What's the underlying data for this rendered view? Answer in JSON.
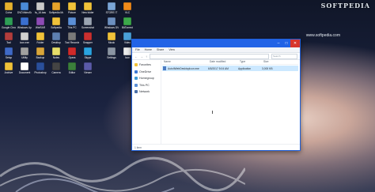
{
  "branding": {
    "logo_text": "SOFTPEDIA",
    "url_text": "www.softpedia.com"
  },
  "desktop": {
    "icons": [
      {
        "label": "Coinz",
        "color": "#e6b12e"
      },
      {
        "label": "DVDVideoSoft",
        "color": "#4a8bd8"
      },
      {
        "label": "fa_16.bas",
        "color": "#c9c9c9"
      },
      {
        "label": "Softpedia Music",
        "color": "#e6a32b"
      },
      {
        "label": "Picture",
        "color": "#f0c23a"
      },
      {
        "label": "New folder",
        "color": "#f0c23a"
      },
      {
        "label": "STORE IT",
        "color": "#7aa5d6"
      },
      {
        "label": "VLC",
        "color": "#f08a1a"
      },
      {
        "label": "Google Chrome",
        "color": "#2f9e56"
      },
      {
        "label": "Windows Update",
        "color": "#3a6fd0"
      },
      {
        "label": "WinRAR",
        "color": "#8c4bb4"
      },
      {
        "label": "Softpedia",
        "color": "#f0c23a"
      },
      {
        "label": "This PC",
        "color": "#5b8fd6"
      },
      {
        "label": "Screenshot",
        "color": "#9aa4b2"
      },
      {
        "label": "Windows DVD",
        "color": "#6c8fbf"
      },
      {
        "label": "BitTorrent",
        "color": "#3ca84a"
      },
      {
        "label": "Tool",
        "color": "#b33d3d"
      },
      {
        "label": "icon.exe",
        "color": "#d0d0d0"
      },
      {
        "label": "Folder",
        "color": "#f0c23a"
      },
      {
        "label": "Desktop",
        "color": "#5d7fb0"
      },
      {
        "label": "Tool Recorder",
        "color": "#7a7a7a"
      },
      {
        "label": "Snapper",
        "color": "#ca3030"
      },
      {
        "label": "Music",
        "color": "#f0c23a"
      },
      {
        "label": "Video",
        "color": "#4aa1d8"
      },
      {
        "label": "Setup",
        "color": "#3f69c6"
      },
      {
        "label": "Utility",
        "color": "#a0a0a0"
      },
      {
        "label": "Backup",
        "color": "#d9a53a"
      },
      {
        "label": "Notes",
        "color": "#e6dd6a"
      },
      {
        "label": "Opera",
        "color": "#cf2a2a"
      },
      {
        "label": "Skype",
        "color": "#2aa3e0"
      },
      {
        "label": "Settings",
        "color": "#8b95a3"
      },
      {
        "label": "Icon",
        "color": "#ededed"
      },
      {
        "label": "Archive",
        "color": "#f0c23a"
      },
      {
        "label": "Document",
        "color": "#ffffff"
      },
      {
        "label": "Photoshop",
        "color": "#2a4f9a"
      },
      {
        "label": "Camera",
        "color": "#444"
      },
      {
        "label": "Editor",
        "color": "#3b7f3b"
      },
      {
        "label": "Viewer",
        "color": "#5a5aa8"
      }
    ]
  },
  "window": {
    "title": "",
    "controls": {
      "minimize": "–",
      "maximize": "□",
      "close": "✕"
    },
    "ribbon": [
      "File",
      "Home",
      "Share",
      "View"
    ],
    "search_placeholder": "Search",
    "nav_items": [
      {
        "label": "Favorites",
        "color": "#f0c23a"
      },
      {
        "label": "OneDrive",
        "color": "#3d7ad6"
      },
      {
        "label": "Homegroup",
        "color": "#3d9ad6"
      },
      {
        "label": "This PC",
        "color": "#5b8fd6"
      },
      {
        "label": "Network",
        "color": "#4a6fa8"
      }
    ],
    "columns": [
      "Name",
      "Date modified",
      "Type",
      "Size"
    ],
    "file": {
      "name": "AutoItWebDesktopIcon.exe",
      "date": "6/5/2017 5:04 AM",
      "type": "Application",
      "size": "3,000 KB"
    },
    "status": "1 item"
  }
}
